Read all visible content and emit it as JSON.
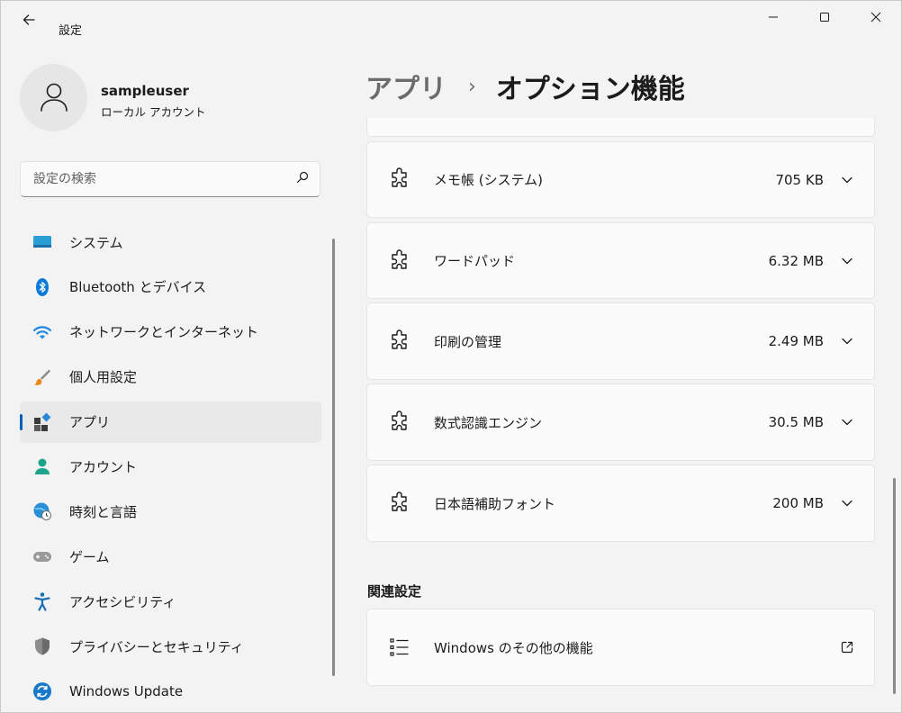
{
  "window": {
    "title": "設定",
    "back_icon": "back-arrow-icon",
    "controls": [
      "minimize-icon",
      "maximize-icon",
      "close-icon"
    ]
  },
  "user": {
    "name": "sampleuser",
    "account_type": "ローカル アカウント",
    "avatar_icon": "person-icon"
  },
  "search": {
    "placeholder": "設定の検索",
    "value": "",
    "icon": "search-icon"
  },
  "sidebar": {
    "items": [
      {
        "label": "システム",
        "icon": "system-display-icon",
        "active": false
      },
      {
        "label": "Bluetooth とデバイス",
        "icon": "bluetooth-icon",
        "active": false
      },
      {
        "label": "ネットワークとインターネット",
        "icon": "wifi-icon",
        "active": false
      },
      {
        "label": "個人用設定",
        "icon": "brush-icon",
        "active": false
      },
      {
        "label": "アプリ",
        "icon": "apps-icon",
        "active": true
      },
      {
        "label": "アカウント",
        "icon": "account-icon",
        "active": false
      },
      {
        "label": "時刻と言語",
        "icon": "globe-clock-icon",
        "active": false
      },
      {
        "label": "ゲーム",
        "icon": "gamepad-icon",
        "active": false
      },
      {
        "label": "アクセシビリティ",
        "icon": "accessibility-icon",
        "active": false
      },
      {
        "label": "プライバシーとセキュリティ",
        "icon": "shield-icon",
        "active": false
      },
      {
        "label": "Windows Update",
        "icon": "update-icon",
        "active": false
      }
    ]
  },
  "breadcrumb": {
    "parent": "アプリ",
    "separator": "›",
    "current": "オプション機能"
  },
  "features": [
    {
      "name": "メモ帳 (システム)",
      "size": "705 KB",
      "icon": "puzzle-icon"
    },
    {
      "name": "ワードパッド",
      "size": "6.32 MB",
      "icon": "puzzle-icon"
    },
    {
      "name": "印刷の管理",
      "size": "2.49 MB",
      "icon": "puzzle-icon"
    },
    {
      "name": "数式認識エンジン",
      "size": "30.5 MB",
      "icon": "puzzle-icon"
    },
    {
      "name": "日本語補助フォント",
      "size": "200 MB",
      "icon": "puzzle-icon"
    }
  ],
  "related": {
    "title": "関連設定",
    "items": [
      {
        "label": "Windows のその他の機能",
        "icon": "list-icon",
        "action_icon": "open-external-icon"
      }
    ]
  },
  "colors": {
    "accent": "#005fb8",
    "background": "#f3f3f3",
    "card": "#fbfbfb"
  }
}
